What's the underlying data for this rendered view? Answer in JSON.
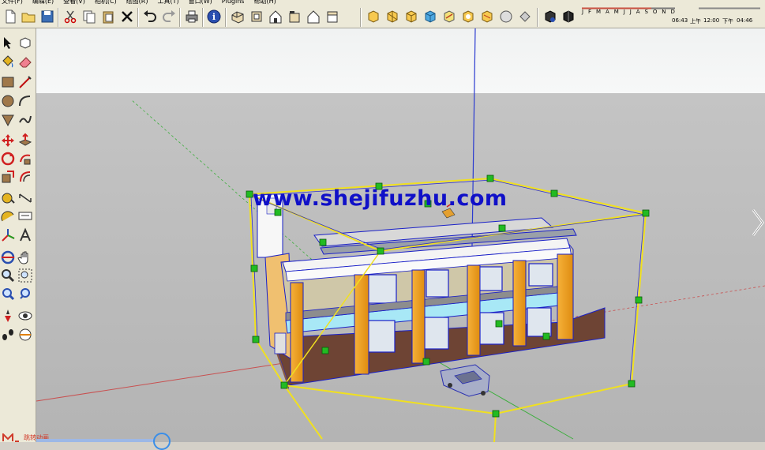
{
  "menu": {
    "items": [
      "文件(F)",
      "编辑(E)",
      "查看(V)",
      "相机(C)",
      "绘图(R)",
      "工具(T)",
      "窗口(W)",
      "Plugins",
      "帮助(H)"
    ]
  },
  "shadow": {
    "months": [
      "J",
      "F",
      "M",
      "A",
      "M",
      "J",
      "J",
      "A",
      "S",
      "O",
      "N",
      "D"
    ],
    "time_start": "06:43",
    "am_label": "上午",
    "noon": "12:00",
    "pm_label": "下午",
    "time_end": "04:46"
  },
  "viewport": {
    "watermark": "www.shejifuzhu.com"
  },
  "status": {
    "text": "跳转动画"
  },
  "colors": {
    "accent_blue": "#1010c8",
    "selection_yellow": "#f0e020",
    "grip_green": "#22bb22",
    "sky": "#f2f4f4",
    "ground": "#bbbbbb"
  }
}
